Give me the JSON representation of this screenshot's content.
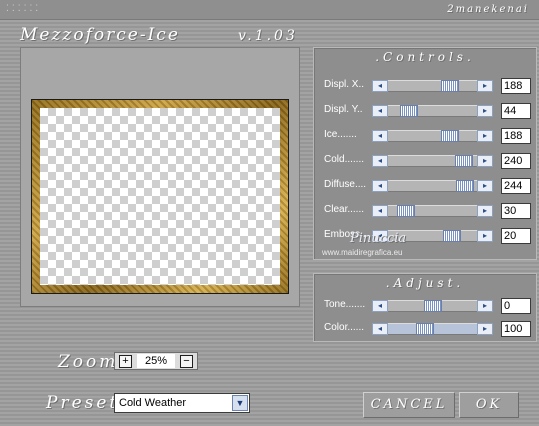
{
  "window": {
    "drag_dots": "⁚⁚⁚⁚⁚⁚",
    "author": "2manekenai",
    "title": "Mezzoforce-Ice",
    "version": "v.1.03"
  },
  "controls": {
    "title": ".Controls.",
    "sliders": [
      {
        "label": "Displ. X..",
        "value": "188",
        "level": 0.74
      },
      {
        "label": "Displ. Y..",
        "value": "44",
        "level": 0.17
      },
      {
        "label": "Ice.......",
        "value": "188",
        "level": 0.74
      },
      {
        "label": "Cold.......",
        "value": "240",
        "level": 0.94
      },
      {
        "label": "Diffuse....",
        "value": "244",
        "level": 0.96
      },
      {
        "label": "Clear......",
        "value": "30",
        "level": 0.12
      },
      {
        "label": "Emboss....",
        "value": "20",
        "level": 0.78
      }
    ]
  },
  "adjust": {
    "title": ".Adjust.",
    "sliders": [
      {
        "label": "Tone.......",
        "value": "0",
        "level": 0.5
      },
      {
        "label": "Color......",
        "value": "100",
        "level": 0.4
      }
    ]
  },
  "watermark": {
    "name": "Pinuccia",
    "url": "www.maidiregrafica.eu"
  },
  "zoom": {
    "label": "Zoom",
    "value": "25%",
    "plus": "+",
    "minus": "−"
  },
  "preset": {
    "label": "Preset",
    "selected": "Cold Weather"
  },
  "buttons": {
    "cancel": "CANCEL",
    "ok": "OK"
  },
  "colors": {
    "background": "#9c9c9c",
    "slider_thumb": "#7a93c4",
    "frame_gold": "#c9a043"
  },
  "icons": {
    "arrow_left": "chevron-left-icon",
    "arrow_right": "chevron-right-icon",
    "dropdown": "chevron-down-icon"
  }
}
